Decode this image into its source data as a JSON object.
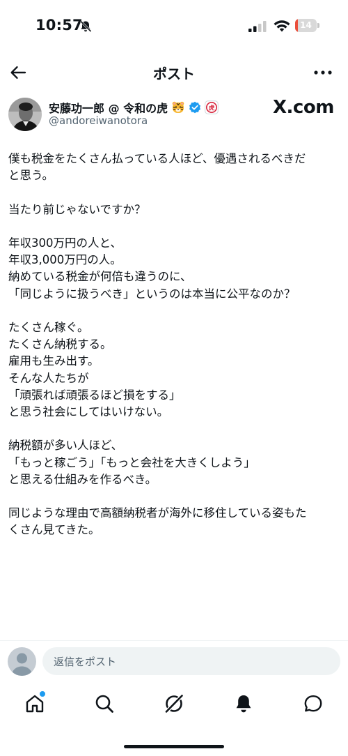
{
  "status_bar": {
    "time": "10:57",
    "battery_percent": "14",
    "battery_level": 0.14
  },
  "header": {
    "title": "ポスト"
  },
  "author": {
    "display_name": "安藤功一郎 @ 令和の虎",
    "handle": "@andoreiwanotora",
    "badge_text": "虎",
    "source_logo": "X.com"
  },
  "post": {
    "lines": [
      "僕も税金をたくさん払っている人ほど、優遇されるべきだ",
      "と思う。",
      "",
      "当たり前じゃないですか？",
      "",
      "年収300万円の人と、",
      "年収3,000万円の人。",
      "納めている税金が何倍も違うのに、",
      "「同じように扱うべき」というのは本当に公平なのか？",
      "",
      "たくさん稼ぐ。",
      "たくさん納税する。",
      "雇用も生み出す。",
      "そんな人たちが",
      "「頑張れば頑張るほど損をする」",
      "と思う社会にしてはいけない。",
      "",
      "納税額が多い人ほど、",
      "「もっと稼ごう」「もっと会社を大きくしよう」",
      "と思える仕組みを作るべき。",
      "",
      "同じような理由で高額納税者が海外に移住している姿もた",
      "くさん見てきた。"
    ]
  },
  "reply": {
    "placeholder": "返信をポスト"
  },
  "colors": {
    "accent": "#1d9bf0",
    "text": "#0f1419",
    "muted": "#536471",
    "battery_low": "#ea4f3c"
  },
  "icons": {
    "back": "arrow-left-icon",
    "more": "more-horizontal-icon",
    "home": "home-icon",
    "search": "search-icon",
    "grok": "grok-icon",
    "notifications": "bell-icon",
    "messages": "chat-icon"
  }
}
